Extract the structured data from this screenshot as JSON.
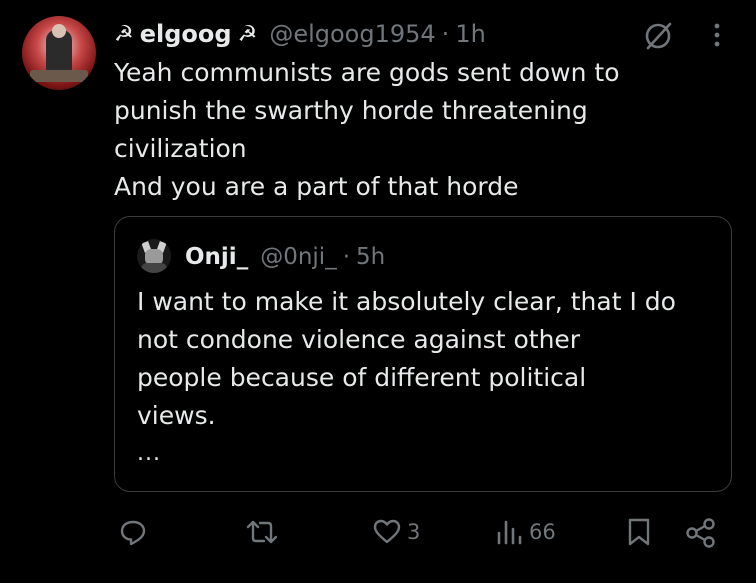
{
  "author": {
    "display_name": "elgoog",
    "name_prefix_emoji": "☭",
    "name_suffix_emoji": "☭",
    "handle": "@elgoog1954",
    "separator": "·",
    "time": "1h"
  },
  "post": {
    "lines": [
      "Yeah communists are gods sent down to",
      "punish the swarthy horde threatening",
      "civilization",
      "And you are a part of that horde"
    ]
  },
  "quote": {
    "display_name": "Onji_",
    "handle": "@0nji_",
    "separator": "·",
    "time": "5h",
    "lines": [
      "I want to make it absolutely clear, that I do",
      "not condone violence against other",
      "people because of different political",
      "views."
    ],
    "truncation": "..."
  },
  "actions": {
    "reply_icon": "reply-icon",
    "repost_icon": "repost-icon",
    "like_icon": "heart-icon",
    "like_count": "3",
    "views_icon": "views-icon",
    "views_count": "66",
    "bookmark_icon": "bookmark-icon",
    "share_icon": "share-icon"
  },
  "colors": {
    "background": "#000000",
    "primary_text": "#e7e9ea",
    "secondary_text": "#71767b",
    "border": "#3a3d40"
  }
}
